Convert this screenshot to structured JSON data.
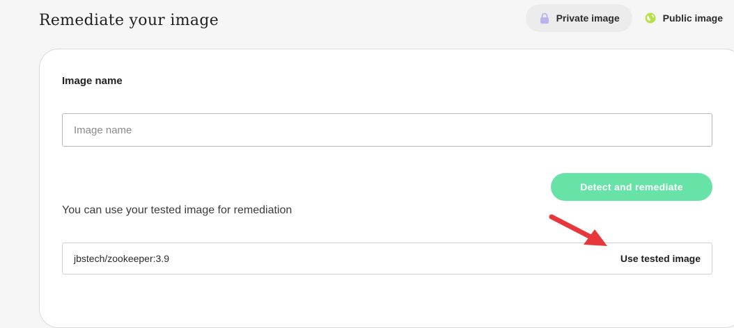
{
  "page": {
    "title": "Remediate your image"
  },
  "visibility": {
    "private_label": "Private image",
    "public_label": "Public image",
    "selected": "private",
    "private_icon": "lock-icon",
    "public_icon": "globe-icon",
    "private_icon_color": "#b9b4ee",
    "public_icon_color": "#b8e04b"
  },
  "form": {
    "image_name_label": "Image name",
    "image_name_value": "",
    "image_name_placeholder": "Image name",
    "detect_button_label": "Detect and remediate",
    "detect_button_color": "#67e3a8"
  },
  "tested": {
    "hint": "You can use your tested image for remediation",
    "image_value": "jbstech/zookeeper:3.9",
    "use_button_label": "Use tested image"
  },
  "annotation": {
    "icon": "red-arrow-icon",
    "color": "#e8373a"
  }
}
